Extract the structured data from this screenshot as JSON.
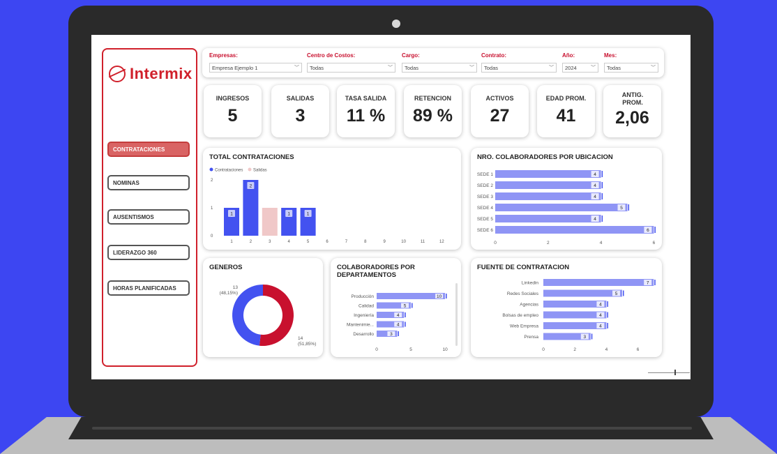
{
  "logo": {
    "text": "Intermix"
  },
  "nav": [
    {
      "label": "CONTRATACIONES",
      "active": true
    },
    {
      "label": "NOMINAS",
      "active": false
    },
    {
      "label": "AUSENTISMOS",
      "active": false
    },
    {
      "label": "LIDERAZGO 360",
      "active": false
    },
    {
      "label": "HORAS PLANIFICADAS",
      "active": false
    }
  ],
  "filters": [
    {
      "label": "Empresas:",
      "value": "Empresa Ejemplo 1"
    },
    {
      "label": "Centro de Costos:",
      "value": "Todas"
    },
    {
      "label": "Cargo:",
      "value": "Todas"
    },
    {
      "label": "Contrato:",
      "value": "Todas"
    },
    {
      "label": "Año:",
      "value": "2024"
    },
    {
      "label": "Mes:",
      "value": "Todas"
    }
  ],
  "kpis": [
    {
      "label": "INGRESOS",
      "value": "5"
    },
    {
      "label": "SALIDAS",
      "value": "3"
    },
    {
      "label": "TASA SALIDA",
      "value": "11 %"
    },
    {
      "label": "RETENCION",
      "value": "89 %"
    },
    {
      "label": "ACTIVOS",
      "value": "27"
    },
    {
      "label": "EDAD PROM.",
      "value": "41"
    },
    {
      "label": "ANTIG. PROM.",
      "value": "2,06"
    }
  ],
  "panels": {
    "contrataciones": {
      "title": "TOTAL CONTRATACIONES"
    },
    "ubicacion": {
      "title": "NRO. COLABORADORES POR UBICACION"
    },
    "generos": {
      "title": "GENEROS"
    },
    "departamentos": {
      "title": "COLABORADORES POR DEPARTAMENTOS"
    },
    "fuente": {
      "title": "FUENTE DE CONTRATACION"
    }
  },
  "colors": {
    "accent": "#d0202b",
    "blue": "#4352f0",
    "pink": "#f0c8c8",
    "barblue": "#8f95f5"
  },
  "chart_data": [
    {
      "type": "bar",
      "title": "TOTAL CONTRATACIONES",
      "categories": [
        "1",
        "2",
        "3",
        "4",
        "5",
        "6",
        "7",
        "8",
        "9",
        "10",
        "11",
        "12"
      ],
      "series": [
        {
          "name": "Contrataciones",
          "values": [
            1,
            2,
            0,
            1,
            1,
            0,
            0,
            0,
            0,
            0,
            0,
            0
          ]
        },
        {
          "name": "Salidas",
          "values": [
            1,
            0,
            1,
            1,
            0,
            0,
            0,
            0,
            0,
            0,
            0,
            0
          ]
        }
      ],
      "yticks": [
        "0",
        "1",
        "2"
      ],
      "ylim": [
        0,
        2
      ]
    },
    {
      "type": "bar",
      "title": "NRO. COLABORADORES POR UBICACION",
      "categories": [
        "SEDE 1",
        "SEDE 2",
        "SEDE 3",
        "SEDE 4",
        "SEDE 5",
        "SEDE 6"
      ],
      "values": [
        4,
        4,
        4,
        5,
        4,
        6
      ],
      "xticks": [
        "0",
        "2",
        "4",
        "6"
      ],
      "xlim": [
        0,
        6.2
      ]
    },
    {
      "type": "pie",
      "title": "GENEROS",
      "slices": [
        {
          "value": 13,
          "label": "13",
          "pct": "(48,15%)",
          "color": "#4352f0"
        },
        {
          "value": 14,
          "label": "14",
          "pct": "(51,85%)",
          "color": "#c8102e"
        }
      ]
    },
    {
      "type": "bar",
      "title": "COLABORADORES POR DEPARTAMENTOS",
      "categories": [
        "Producción",
        "Calidad",
        "Ingeniería",
        "Mantenimie...",
        "Desarrollo"
      ],
      "values": [
        10,
        5,
        4,
        4,
        3
      ],
      "xticks": [
        "0",
        "5",
        "10"
      ],
      "xlim": [
        0,
        10.5
      ]
    },
    {
      "type": "bar",
      "title": "FUENTE DE CONTRATACION",
      "categories": [
        "Linkedin",
        "Redes Sociales",
        "Agencias",
        "Bolsas de empleo",
        "Web Empresa",
        "Prensa"
      ],
      "values": [
        7,
        5,
        4,
        4,
        4,
        3
      ],
      "xticks": [
        "0",
        "2",
        "4",
        "6"
      ],
      "xlim": [
        0,
        7.3
      ]
    }
  ]
}
